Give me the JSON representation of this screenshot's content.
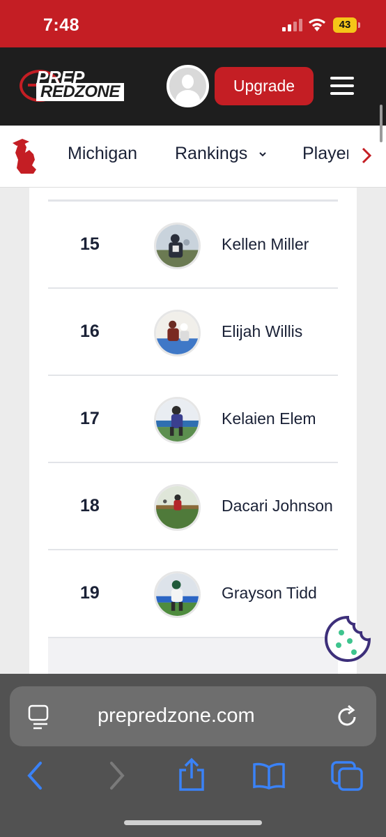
{
  "status_bar": {
    "time": "7:48",
    "battery": "43"
  },
  "header": {
    "brand_top": "PREP",
    "brand_bottom": "REDZONE",
    "upgrade_label": "Upgrade"
  },
  "nav": {
    "items": [
      "Michigan",
      "Rankings",
      "Players"
    ]
  },
  "rankings": [
    {
      "rank": "15",
      "name": "Kellen Miller"
    },
    {
      "rank": "16",
      "name": "Elijah Willis"
    },
    {
      "rank": "17",
      "name": "Kelaien Elem"
    },
    {
      "rank": "18",
      "name": "Dacari Johnson"
    },
    {
      "rank": "19",
      "name": "Grayson Tidd"
    }
  ],
  "browser": {
    "url": "prepredzone.com"
  },
  "colors": {
    "brand_red": "#c41e24",
    "header_dark": "#1e1e1e",
    "text_navy": "#1a2136",
    "ios_blue": "#3a82f7"
  }
}
